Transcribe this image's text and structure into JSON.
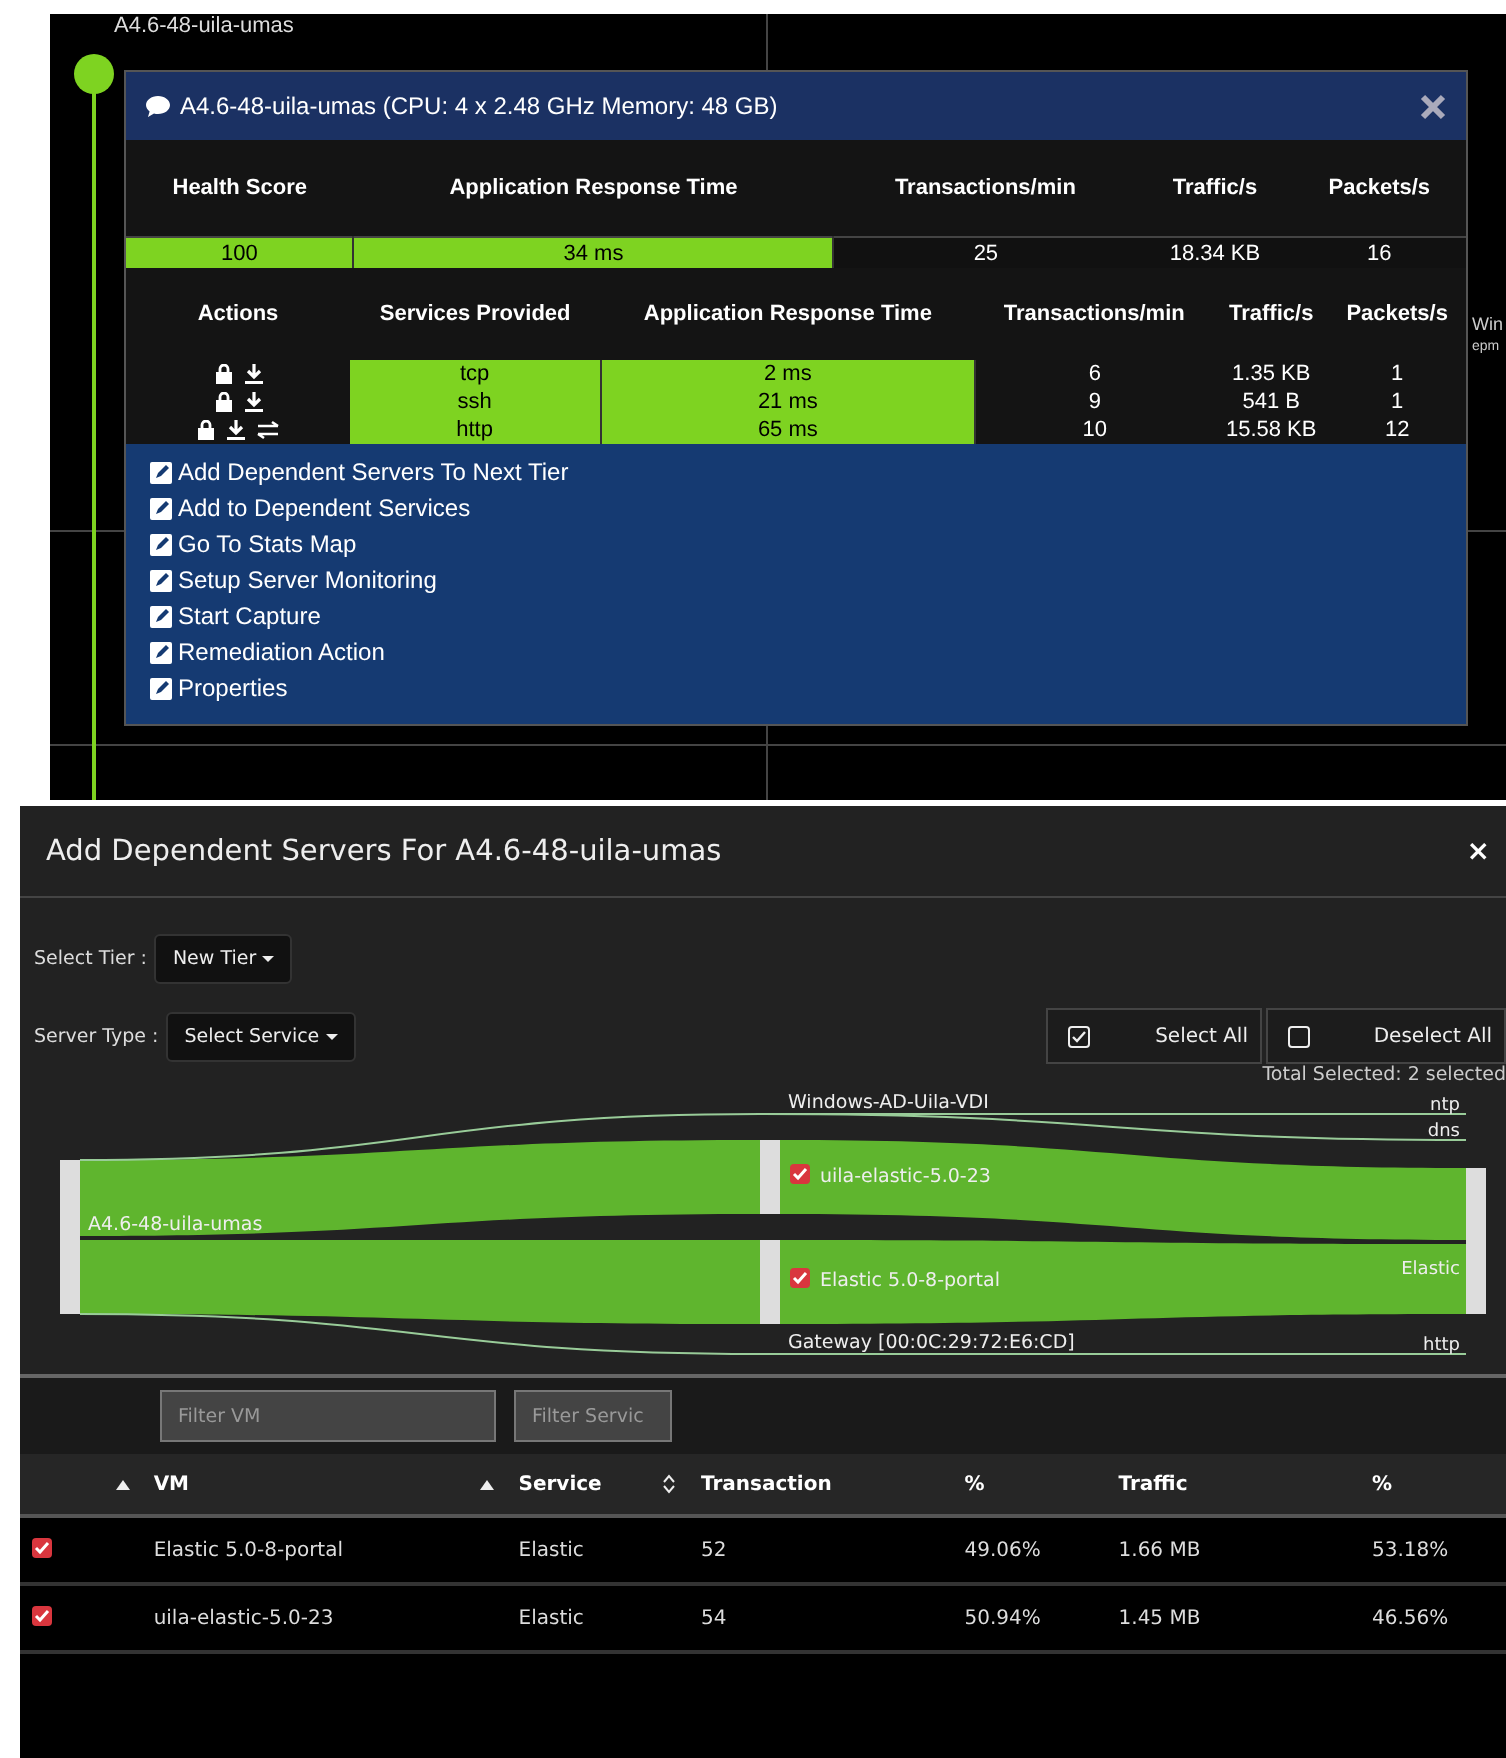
{
  "map": {
    "node_label": "A4.6-48-uila-umas",
    "side_label": "Win",
    "side_sublabel": "epm"
  },
  "popup": {
    "title": "A4.6-48-uila-umas (CPU: 4 x 2.48 GHz Memory: 48 GB)",
    "summary": {
      "columns": [
        "Health Score",
        "Application Response Time",
        "Transactions/min",
        "Traffic/s",
        "Packets/s"
      ],
      "values": [
        {
          "text": "100",
          "highlight": true
        },
        {
          "text": "34 ms",
          "highlight": true
        },
        {
          "text": "25",
          "highlight": false
        },
        {
          "text": "18.34 KB",
          "highlight": false
        },
        {
          "text": "16",
          "highlight": false
        }
      ]
    },
    "services": {
      "actions_header": "Actions",
      "columns": [
        "Services Provided",
        "Application Response Time",
        "Transactions/min",
        "Traffic/s",
        "Packets/s"
      ],
      "rows": [
        {
          "actions": [
            {
              "kind": "lock"
            },
            {
              "kind": "download"
            }
          ],
          "cells": [
            {
              "text": "tcp",
              "highlight": true
            },
            {
              "text": "2 ms",
              "highlight": true
            },
            {
              "text": "6",
              "highlight": false
            },
            {
              "text": "1.35 KB",
              "highlight": false
            },
            {
              "text": "1",
              "highlight": false
            }
          ]
        },
        {
          "actions": [
            {
              "kind": "lock"
            },
            {
              "kind": "download"
            }
          ],
          "cells": [
            {
              "text": "ssh",
              "highlight": true
            },
            {
              "text": "21 ms",
              "highlight": true
            },
            {
              "text": "9",
              "highlight": false
            },
            {
              "text": "541 B",
              "highlight": false
            },
            {
              "text": "1",
              "highlight": false
            }
          ]
        },
        {
          "actions": [
            {
              "kind": "lock"
            },
            {
              "kind": "download"
            },
            {
              "kind": "transfer"
            }
          ],
          "cells": [
            {
              "text": "http",
              "highlight": true
            },
            {
              "text": "65 ms",
              "highlight": true
            },
            {
              "text": "10",
              "highlight": false
            },
            {
              "text": "15.58 KB",
              "highlight": false
            },
            {
              "text": "12",
              "highlight": false
            }
          ]
        }
      ]
    },
    "menu": [
      "Add Dependent Servers To Next Tier",
      "Add to Dependent Services",
      "Go To Stats Map",
      "Setup Server Monitoring",
      "Start Capture",
      "Remediation Action",
      "Properties"
    ]
  },
  "dialog": {
    "title": "Add Dependent Servers For A4.6-48-uila-umas",
    "close": "×",
    "select_tier": {
      "label": "Select Tier :",
      "value": "New Tier"
    },
    "server_type": {
      "label": "Server Type :",
      "value": "Select Service"
    },
    "select_all": {
      "label": "Select All",
      "checked": true
    },
    "deselect_all": {
      "label": "Deselect All",
      "checked": false
    },
    "total_selected": "Total Selected: 2 selected",
    "sankey": {
      "source": "A4.6-48-uila-umas",
      "top_node": "Windows-AD-Uila-VDI",
      "bottom_node": "Gateway [00:0C:29:72:E6:CD]",
      "middle": [
        {
          "label": "uila-elastic-5.0-23",
          "checked": true
        },
        {
          "label": "Elastic 5.0-8-portal",
          "checked": true
        }
      ],
      "targets": [
        "ntp",
        "dns",
        "Elastic",
        "http"
      ]
    },
    "filters": [
      {
        "placeholder": "Filter VM"
      },
      {
        "placeholder": "Filter Servic"
      }
    ],
    "table": {
      "checkbox_column": {
        "sortable": true,
        "sorted": true
      },
      "columns": [
        {
          "label": "VM",
          "sortable": true,
          "sorted": true
        },
        {
          "label": "Service",
          "sortable": true,
          "sorted": false
        },
        {
          "label": "Transaction",
          "sortable": false
        },
        {
          "label": "%",
          "sortable": false
        },
        {
          "label": "Traffic",
          "sortable": false
        },
        {
          "label": "%",
          "sortable": false
        }
      ],
      "rows": [
        {
          "checked": true,
          "cells": [
            "Elastic 5.0-8-portal",
            "Elastic",
            "52",
            "49.06%",
            "1.66 MB",
            "53.18%"
          ]
        },
        {
          "checked": true,
          "cells": [
            "uila-elastic-5.0-23",
            "Elastic",
            "54",
            "50.94%",
            "1.45 MB",
            "46.56%"
          ]
        }
      ]
    }
  }
}
